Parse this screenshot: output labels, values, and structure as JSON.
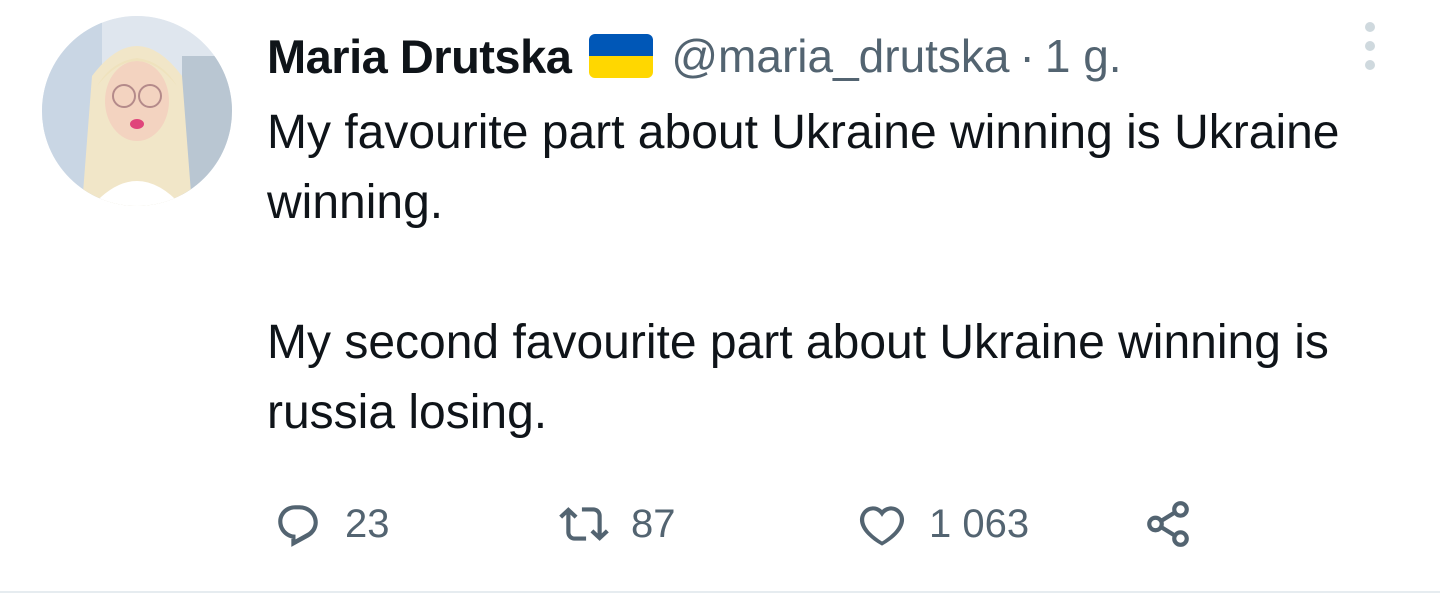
{
  "author": {
    "display_name": "Maria Drutska",
    "handle": "@maria_drutska",
    "separator": "·",
    "time": "1 g.",
    "badge_icon": "ukraine-flag-icon",
    "flag_colors": {
      "top": "#0057B7",
      "bottom": "#FFD700"
    }
  },
  "tweet": {
    "paragraphs": [
      "My favourite part about Ukraine winning is Ukraine winning.",
      "My second favourite part about Ukraine winning is russia losing."
    ]
  },
  "actions": {
    "reply": {
      "icon": "reply-icon",
      "count": "23"
    },
    "retweet": {
      "icon": "retweet-icon",
      "count": "87"
    },
    "like": {
      "icon": "heart-icon",
      "count": "1 063"
    },
    "share": {
      "icon": "share-icon"
    }
  },
  "colors": {
    "text_primary": "#0f1419",
    "text_secondary": "#536471",
    "divider": "#e6ecf0"
  }
}
